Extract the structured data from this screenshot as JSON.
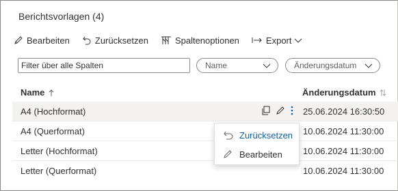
{
  "title": "Berichtsvorlagen (4)",
  "toolbar": {
    "edit": "Bearbeiten",
    "reset": "Zurücksetzen",
    "column_options": "Spaltenoptionen",
    "export": "Export"
  },
  "filters": {
    "search_placeholder": "Filter über alle Spalten",
    "name_dropdown": "Name",
    "date_dropdown": "Änderungsdatum"
  },
  "table": {
    "headers": {
      "name": "Name",
      "date": "Änderungsdatum"
    },
    "rows": [
      {
        "name": "A4 (Hochformat)",
        "date": "25.06.2024 16:30:50"
      },
      {
        "name": "A4 (Querformat)",
        "date": "10.06.2024 11:30:00"
      },
      {
        "name": "Letter (Hochformat)",
        "date": "10.06.2024 11:30:00"
      },
      {
        "name": "Letter (Querformat)",
        "date": "10.06.2024 11:30:00"
      }
    ]
  },
  "context_menu": {
    "reset": "Zurücksetzen",
    "edit": "Bearbeiten"
  },
  "colors": {
    "accent": "#0f5fa3",
    "text": "#323130",
    "selected_row": "#f3f2f1"
  },
  "icons": [
    "pencil-icon",
    "undo-icon",
    "column-options-icon",
    "export-arrow-icon",
    "chevron-down-icon",
    "sort-up-icon",
    "sort-both-icon",
    "copy-icon",
    "more-vertical-icon"
  ]
}
